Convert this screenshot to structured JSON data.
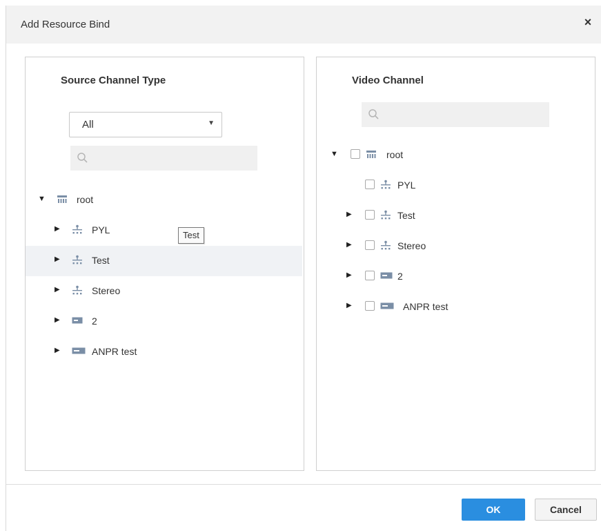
{
  "dialog": {
    "title": "Add Resource Bind",
    "close_glyph": "×"
  },
  "left_panel": {
    "title": "Source Channel Type",
    "dropdown": {
      "selected": "All",
      "arrow": "▼"
    },
    "search": {
      "icon": "search-icon",
      "value": ""
    },
    "tree": {
      "root_label": "root",
      "items": [
        {
          "label": "PYL",
          "icon": "org-icon"
        },
        {
          "label": "Test",
          "icon": "org-icon"
        },
        {
          "label": "Stereo",
          "icon": "org-icon"
        },
        {
          "label": "2",
          "icon": "device-icon"
        },
        {
          "label": "ANPR test",
          "icon": "device-icon"
        }
      ]
    },
    "tooltip": "Test"
  },
  "right_panel": {
    "title": "Video Channel",
    "search": {
      "icon": "search-icon",
      "value": ""
    },
    "tree": {
      "root_label": "root",
      "items": [
        {
          "label": "PYL",
          "icon": "org-icon"
        },
        {
          "label": "Test",
          "icon": "org-icon"
        },
        {
          "label": "Stereo",
          "icon": "org-icon"
        },
        {
          "label": "2",
          "icon": "device-icon"
        },
        {
          "label": "ANPR test",
          "icon": "device-icon"
        }
      ]
    }
  },
  "footer": {
    "ok_label": "OK",
    "cancel_label": "Cancel"
  },
  "colors": {
    "primary": "#2a8ee0",
    "header_bg": "#f2f2f2",
    "hover_bg": "#f0f2f5",
    "icon": "#7a8ea6"
  }
}
